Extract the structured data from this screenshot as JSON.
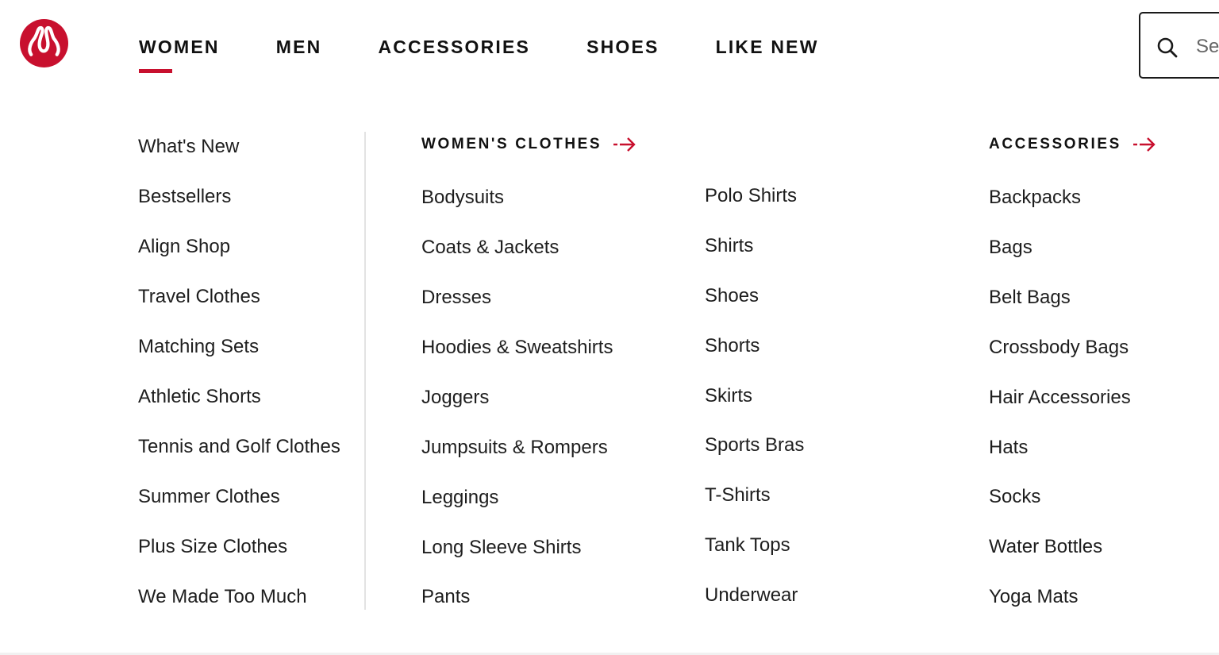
{
  "header": {
    "logo_icon": "lululemon-logo-icon",
    "brand_color": "#c8102e",
    "nav_tabs": [
      {
        "label": "WOMEN",
        "active": true
      },
      {
        "label": "MEN"
      },
      {
        "label": "ACCESSORIES"
      },
      {
        "label": "SHOES"
      },
      {
        "label": "LIKE NEW"
      }
    ],
    "search": {
      "icon": "search-icon",
      "placeholder": "Se"
    }
  },
  "menu": {
    "featured": [
      "What's New",
      "Bestsellers",
      "Align Shop",
      "Travel Clothes",
      "Matching Sets",
      "Athletic Shorts",
      "Tennis and Golf Clothes",
      "Summer Clothes",
      "Plus Size Clothes",
      "We Made Too Much"
    ],
    "clothes": {
      "heading": "WOMEN'S CLOTHES",
      "col1": [
        "Bodysuits",
        "Coats & Jackets",
        "Dresses",
        "Hoodies & Sweatshirts",
        "Joggers",
        "Jumpsuits & Rompers",
        "Leggings",
        "Long Sleeve Shirts",
        "Pants"
      ],
      "col2": [
        "Polo Shirts",
        "Shirts",
        "Shoes",
        "Shorts",
        "Skirts",
        "Sports Bras",
        "T-Shirts",
        "Tank Tops",
        "Underwear"
      ]
    },
    "accessories": {
      "heading": "ACCESSORIES",
      "items": [
        "Backpacks",
        "Bags",
        "Belt Bags",
        "Crossbody Bags",
        "Hair Accessories",
        "Hats",
        "Socks",
        "Water Bottles",
        "Yoga Mats"
      ]
    }
  }
}
